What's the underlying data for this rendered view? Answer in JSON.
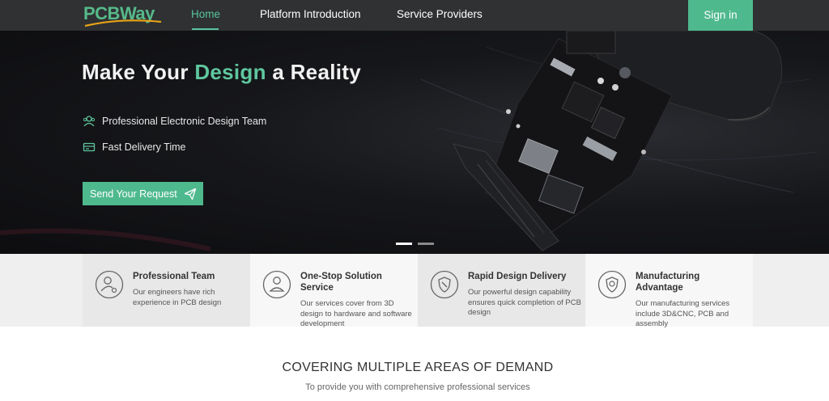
{
  "nav": {
    "logo_text": "PCBWay",
    "links": [
      {
        "label": "Home",
        "active": true
      },
      {
        "label": "Platform Introduction",
        "active": false
      },
      {
        "label": "Service Providers",
        "active": false
      }
    ],
    "signin_label": "Sign in"
  },
  "hero": {
    "title_part1": "Make Your ",
    "title_accent": "Design",
    "title_part2": " a Reality",
    "features": [
      {
        "icon": "team-icon",
        "text": "Professional Electronic Design Team"
      },
      {
        "icon": "delivery-truck-icon",
        "text": "Fast Delivery Time"
      }
    ],
    "cta_label": "Send Your Request",
    "carousel": {
      "slide_count": 2,
      "active_index": 0
    }
  },
  "cards": [
    {
      "icon": "person-gear-icon",
      "title": "Professional Team",
      "desc": "Our engineers have rich experience in PCB design"
    },
    {
      "icon": "person-icon",
      "title": "One-Stop Solution Service",
      "desc": "Our services cover from 3D design to hardware and software development"
    },
    {
      "icon": "shield-tool-icon",
      "title": "Rapid Design Delivery",
      "desc": "Our powerful design capability ensures quick completion of PCB design"
    },
    {
      "icon": "shield-check-icon",
      "title": "Manufacturing Advantage",
      "desc": "Our manufacturing services include 3D&CNC, PCB and assembly"
    }
  ],
  "section": {
    "title": "COVERING MULTIPLE AREAS OF DEMAND",
    "subtitle": "To provide you with comprehensive professional services"
  },
  "colors": {
    "accent": "#4fb98e",
    "accent_text": "#5fc79e",
    "nav_bg": "#2f3133"
  }
}
